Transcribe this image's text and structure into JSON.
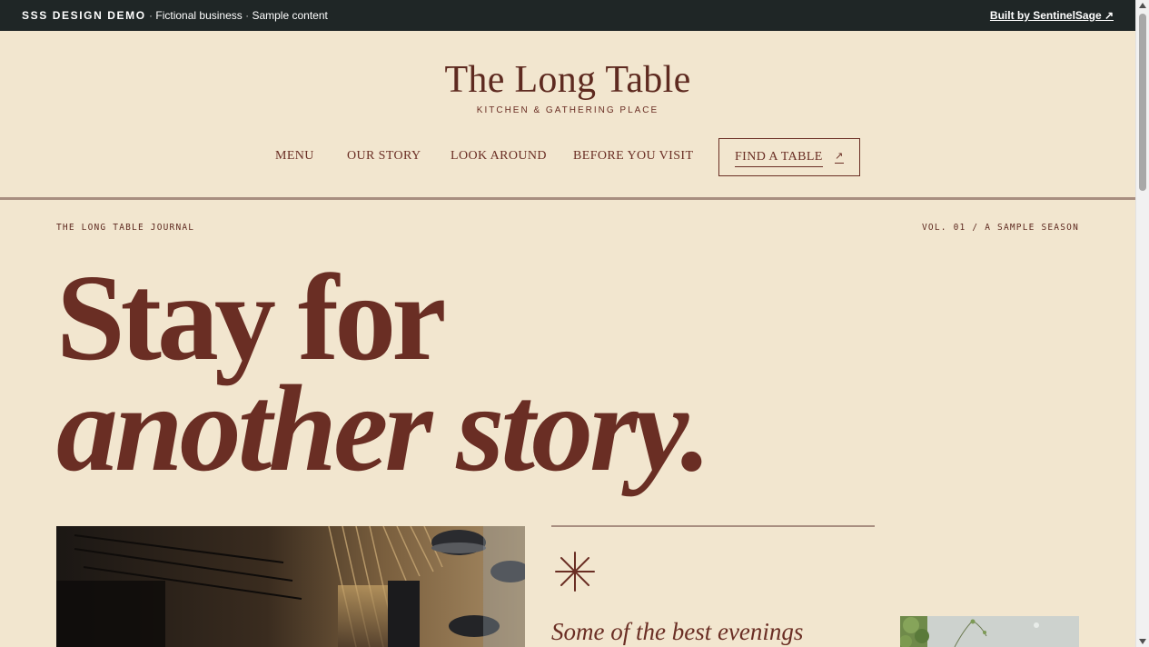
{
  "topbar": {
    "brand": "SSS DESIGN DEMO",
    "separator": "·",
    "fictional": "Fictional business",
    "sample": "Sample content",
    "built_by": "Built by SentinelSage ↗"
  },
  "header": {
    "logo": "The Long Table",
    "tagline": "KITCHEN & GATHERING PLACE",
    "nav": [
      "MENU",
      "OUR STORY",
      "LOOK AROUND",
      "BEFORE YOU VISIT"
    ],
    "cta_label": "FIND A TABLE",
    "cta_arrow": "↗"
  },
  "hero": {
    "journal_label": "THE LONG TABLE JOURNAL",
    "volume_label": "VOL. 01 / A SAMPLE SEASON",
    "headline_line1": "Stay for",
    "headline_line2": "another story.",
    "subhead": "Some of the best evenings"
  },
  "colors": {
    "background": "#f2e6cf",
    "accent": "#6a2e24",
    "topbar": "#1f2626",
    "rule": "#a88e80"
  },
  "icons": {
    "divider": "asterisk-icon",
    "external_link": "arrow-up-right-icon"
  }
}
